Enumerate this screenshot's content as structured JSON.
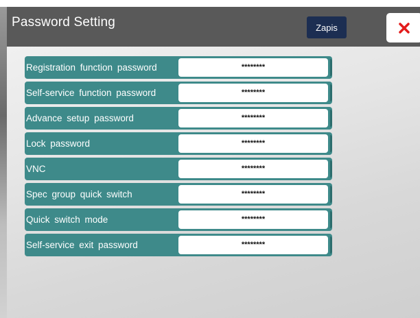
{
  "dialog": {
    "title": "Password Setting",
    "save_label": "Zapis",
    "close_icon": "close-icon",
    "close_color": "#e31c1c"
  },
  "colors": {
    "titlebar": "#595959",
    "row_background": "#3e8a8a",
    "save_button": "#1c2e52"
  },
  "rows": [
    {
      "label": "Registration function password",
      "value": "********"
    },
    {
      "label": "Self-service function password",
      "value": "********"
    },
    {
      "label": "Advance setup password",
      "value": "********"
    },
    {
      "label": "Lock password",
      "value": "********"
    },
    {
      "label": "VNC",
      "value": "********"
    },
    {
      "label": "Spec group quick switch",
      "value": "********"
    },
    {
      "label": "Quick switch mode",
      "value": "********"
    },
    {
      "label": "Self-service exit password",
      "value": "********"
    }
  ]
}
